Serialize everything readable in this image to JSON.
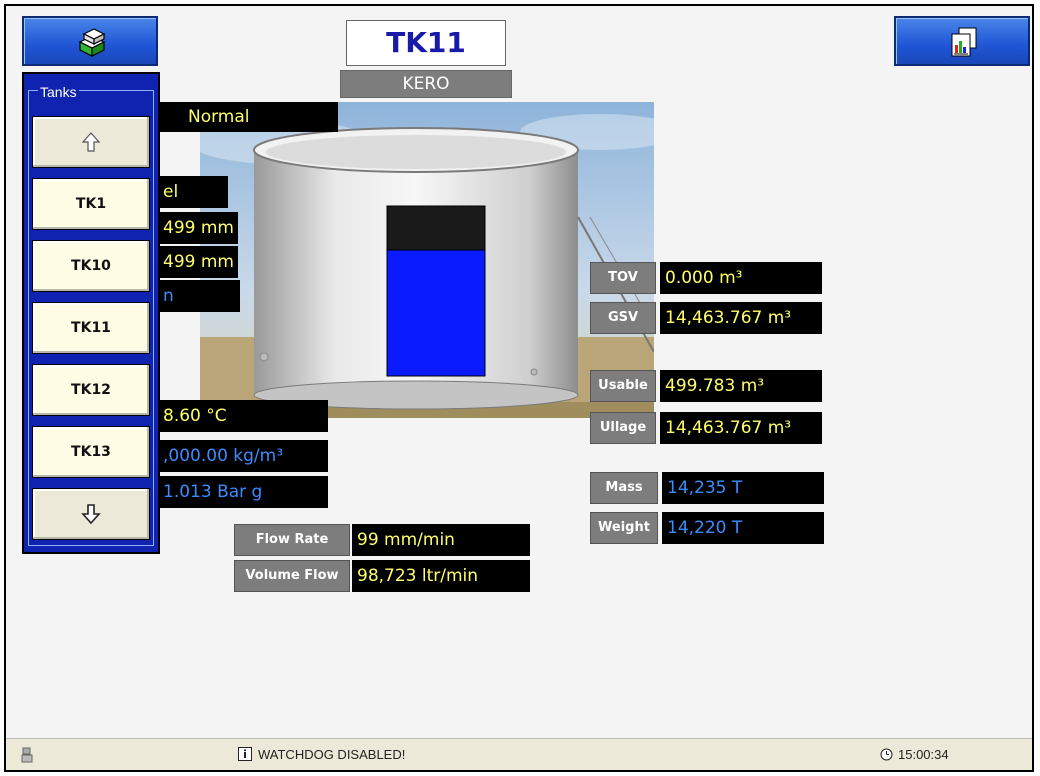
{
  "header": {
    "tank_name": "TK11",
    "product": "KERO"
  },
  "tanks_panel": {
    "legend": "Tanks",
    "items": [
      "TK1",
      "TK10",
      "TK11",
      "TK12",
      "TK13"
    ]
  },
  "status_flag": "Normal",
  "left_readouts": {
    "level_label_fragment": "el",
    "level1": "499 mm",
    "level2": "499 mm",
    "fragment": "n",
    "temperature": "8.60 °C",
    "density": ",000.00 kg/m³",
    "pressure": "1.013 Bar g"
  },
  "tank_fill_fraction": 0.74,
  "flow": {
    "rate_label": "Flow Rate",
    "rate_value": "99 mm/min",
    "volume_label": "Volume Flow",
    "volume_value": "98,723 ltr/min"
  },
  "volumes": {
    "tov_label": "TOV",
    "tov_value": "0.000 m³",
    "gsv_label": "GSV",
    "gsv_value": "14,463.767 m³",
    "usable_label": "Usable",
    "usable_value": "499.783 m³",
    "ullage_label": "Ullage",
    "ullage_value": "14,463.767 m³",
    "mass_label": "Mass",
    "mass_value": "14,235 T",
    "weight_label": "Weight",
    "weight_value": "14,220 T"
  },
  "statusbar": {
    "message": "WATCHDOG DISABLED!",
    "clock": "15:00:34"
  },
  "colors": {
    "panel_blue": "#0f23b0",
    "value_yellow": "#ffff6a",
    "value_blue": "#3a8cff",
    "liquid": "#0a1cff"
  }
}
